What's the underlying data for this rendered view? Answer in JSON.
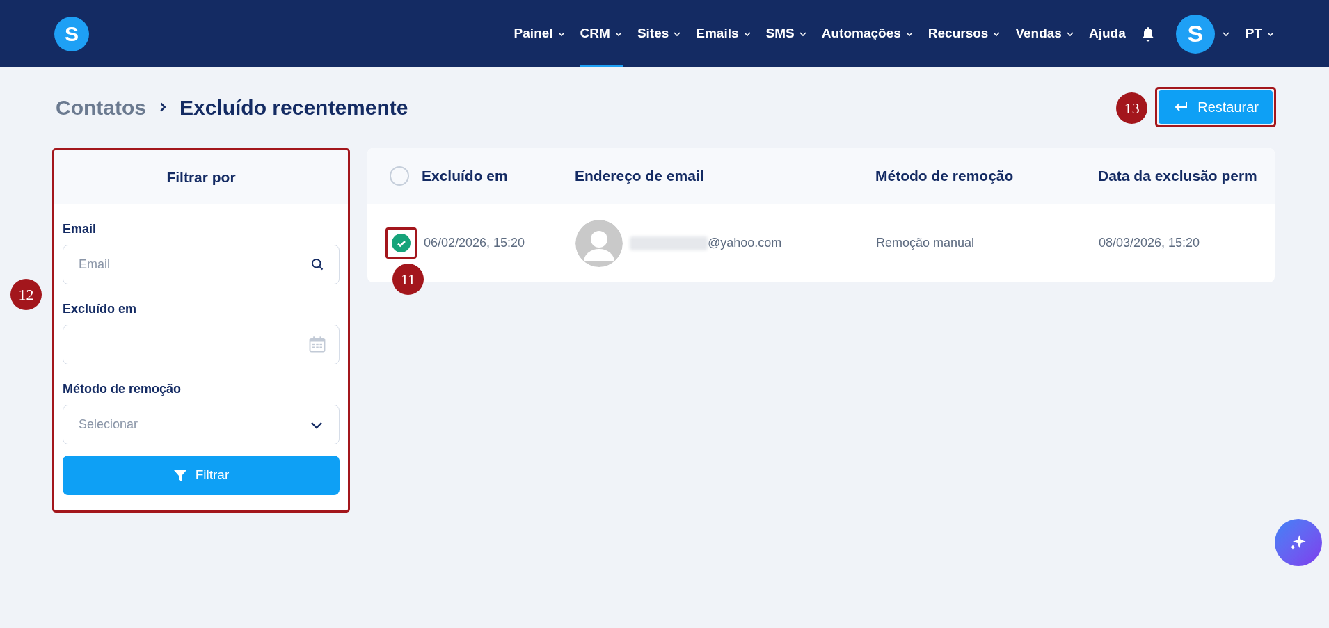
{
  "nav": {
    "items": [
      {
        "label": "Painel",
        "dropdown": true,
        "selected": false
      },
      {
        "label": "CRM",
        "dropdown": true,
        "selected": true
      },
      {
        "label": "Sites",
        "dropdown": true,
        "selected": false
      },
      {
        "label": "Emails",
        "dropdown": true,
        "selected": false
      },
      {
        "label": "SMS",
        "dropdown": true,
        "selected": false
      },
      {
        "label": "Automações",
        "dropdown": true,
        "selected": false
      },
      {
        "label": "Recursos",
        "dropdown": true,
        "selected": false
      },
      {
        "label": "Vendas",
        "dropdown": true,
        "selected": false
      },
      {
        "label": "Ajuda",
        "dropdown": false,
        "selected": false
      }
    ],
    "avatar_letter": "S",
    "language": "PT"
  },
  "logo_letter": "S",
  "breadcrumb": {
    "parent": "Contatos",
    "current": "Excluído recentemente"
  },
  "restore_button": {
    "label": "Restaurar",
    "annotation": "13"
  },
  "filter": {
    "title": "Filtrar por",
    "annotation": "12",
    "fields": [
      {
        "kind": "search",
        "label": "Email",
        "placeholder": "Email"
      },
      {
        "kind": "date",
        "label": "Excluído em"
      },
      {
        "kind": "select",
        "label": "Método de remoção",
        "placeholder": "Selecionar"
      }
    ],
    "button": "Filtrar"
  },
  "table": {
    "columns": [
      "Excluído em",
      "Endereço de email",
      "Método de remoção",
      "Data da exclusão perm"
    ],
    "select_all_checked": false,
    "rows": [
      {
        "checked": true,
        "annotation": "11",
        "deleted_at": "06/02/2026, 15:20",
        "email": "@yahoo.com",
        "email_redacted": true,
        "method": "Remoção manual",
        "permanent_date": "08/03/2026, 15:20"
      }
    ]
  }
}
